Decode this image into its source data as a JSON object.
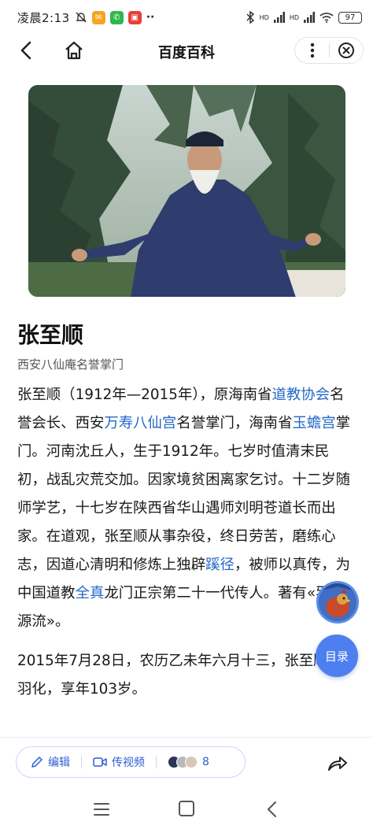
{
  "status_bar": {
    "time": "凌晨2:13",
    "battery": "97",
    "signal_labels": [
      "HD",
      "HD"
    ],
    "overflow": "··"
  },
  "nav": {
    "title": "百度百科"
  },
  "entry": {
    "title": "张至顺",
    "subtitle": "西安八仙庵名誉掌门",
    "p1": [
      {
        "t": "张至顺（1912年—2015年），原海南省"
      },
      {
        "t": "道教协会",
        "link": true
      },
      {
        "t": "名誉会长、西安"
      },
      {
        "t": "万寿八仙宫",
        "link": true
      },
      {
        "t": "名誉掌门，海南省"
      },
      {
        "t": "玉蟾宫",
        "link": true
      },
      {
        "t": "掌门。河南沈丘人，生于1912年。七岁时值清末民初，战乱灾荒交加。因家境贫困离家乞讨。十二岁随师学艺，十七岁在陕西省华山遇师刘明苍道长而出家。在道观，张至顺从事杂役，终日劳苦，磨练心志，因道心清明和修炼上独辟"
      },
      {
        "t": "蹊径",
        "link": true
      },
      {
        "t": "，被师以真传，为中国道教"
      },
      {
        "t": "全真",
        "link": true
      },
      {
        "t": "龙门正宗第二十一代传人。著有«炁体源流»。"
      }
    ],
    "p2": "2015年7月28日，农历乙未年六月十三，张至顺道长羽化，享年103岁。"
  },
  "float": {
    "toc_label": "目录"
  },
  "toolbar": {
    "edit_label": "编辑",
    "video_label": "传视频",
    "contributors_count": "8"
  },
  "colors": {
    "link": "#2468c8",
    "accent": "#4d7ff0",
    "toolbar_text": "#2b5fd0"
  }
}
